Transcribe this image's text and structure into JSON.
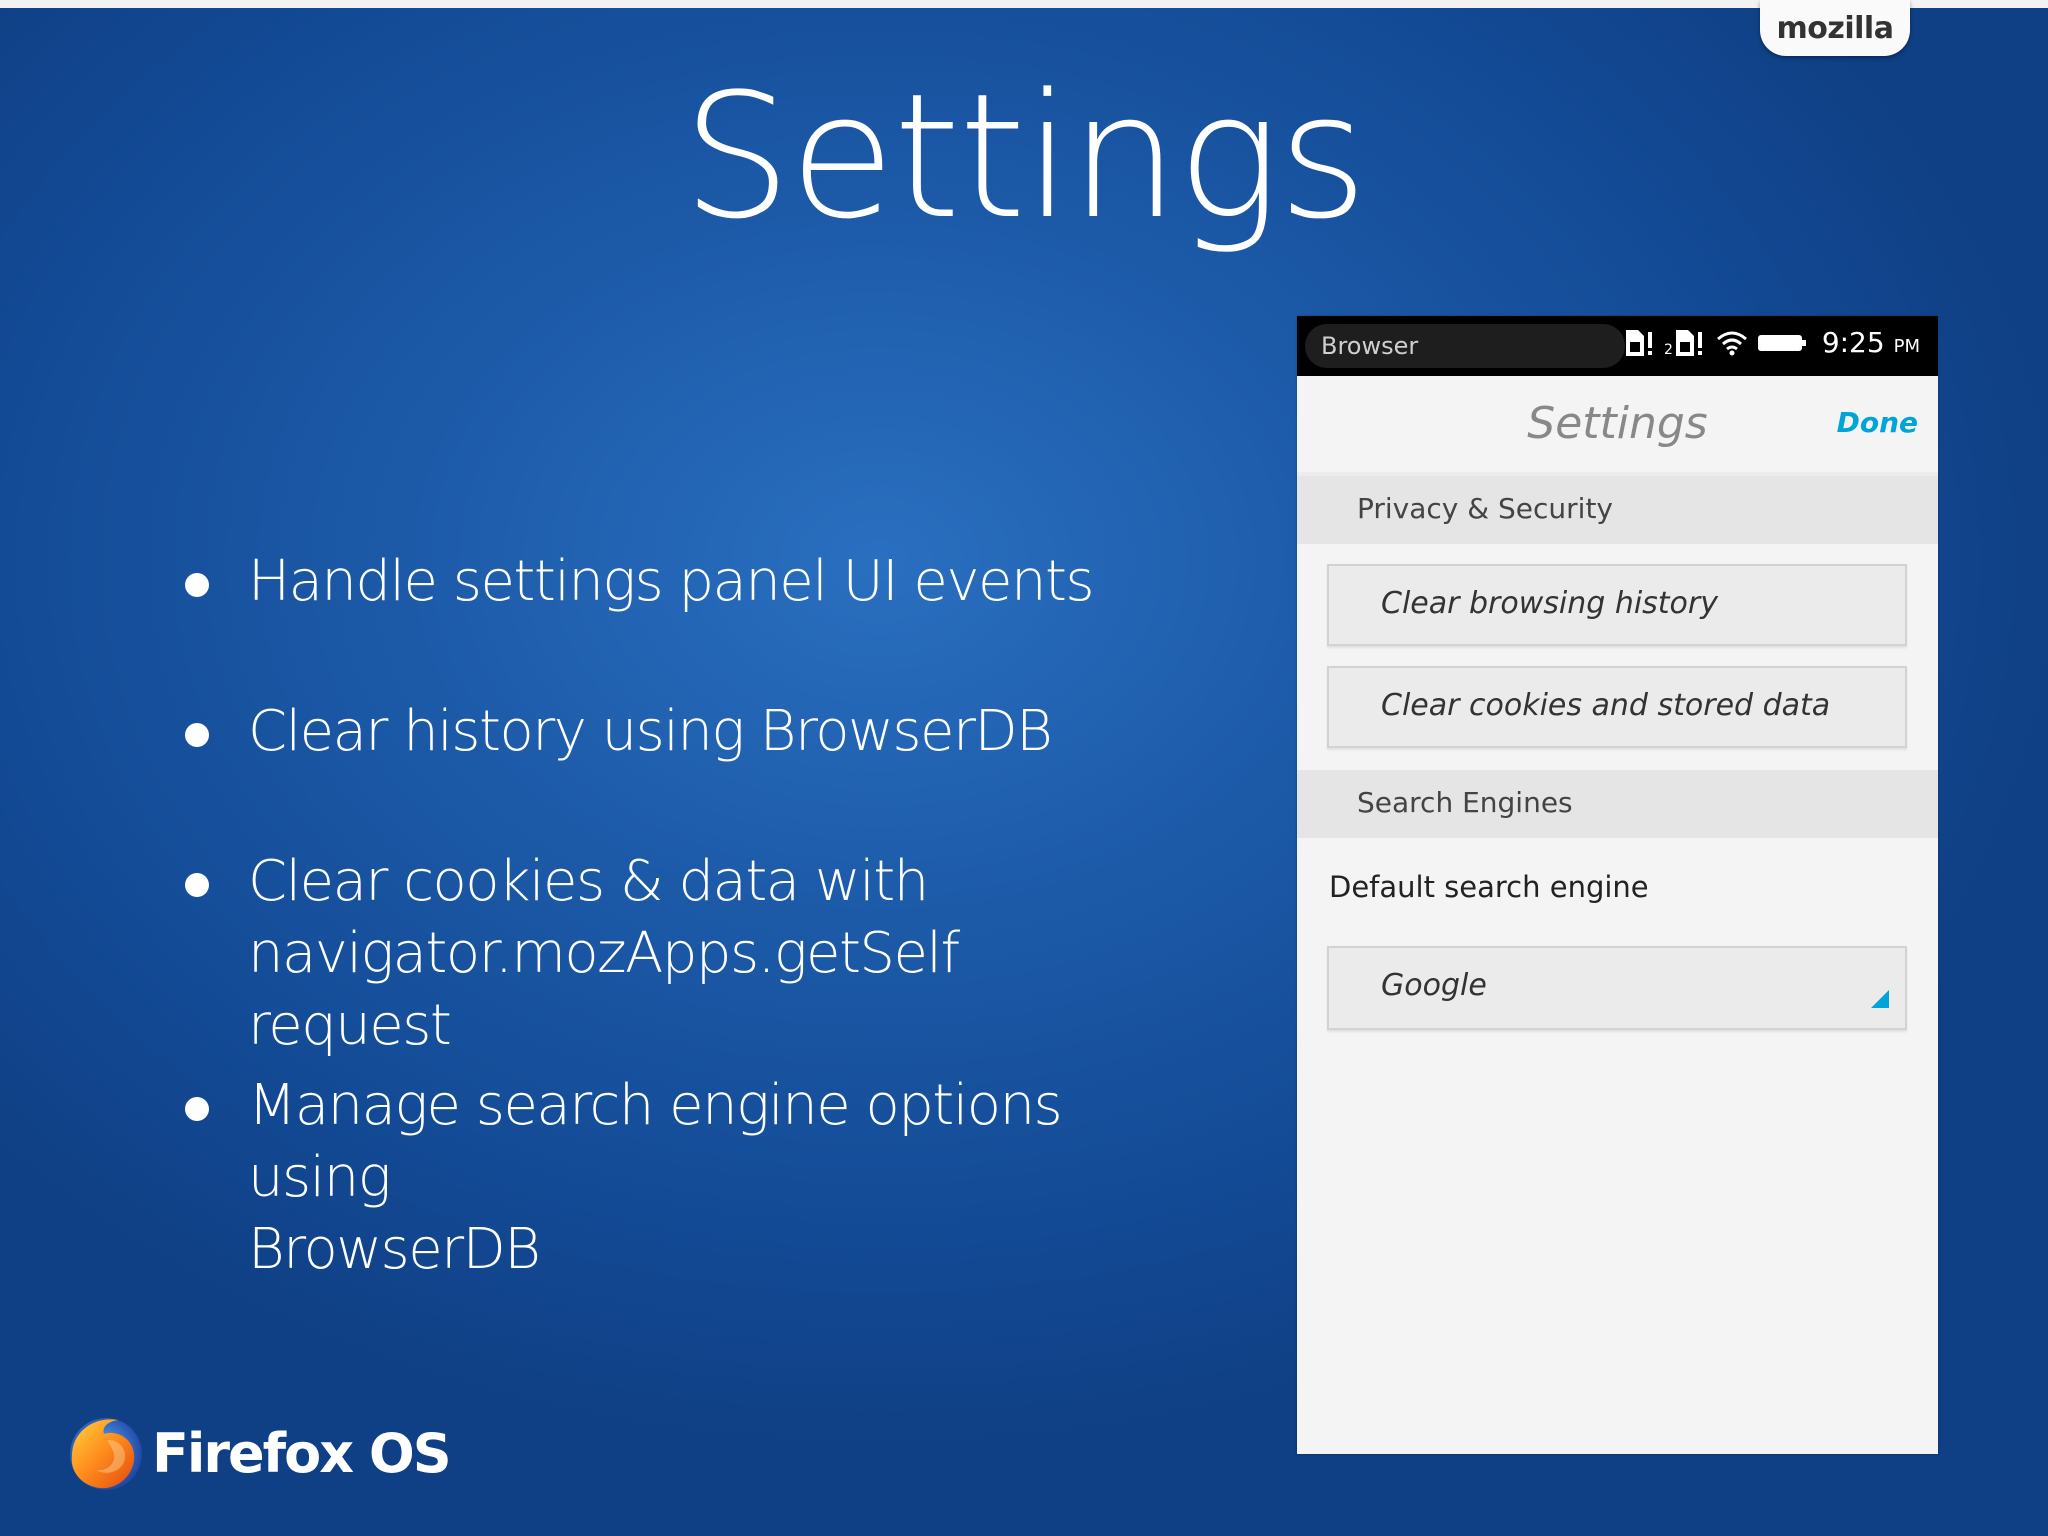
{
  "brand": {
    "tab_label": "mozilla",
    "logo_text": "Firefox OS"
  },
  "slide": {
    "title": "Settings",
    "bullets": [
      {
        "line1": "Handle settings panel UI events"
      },
      {
        "line1": "Clear history using BrowserDB"
      },
      {
        "line1": "Clear cookies & data with",
        "line2": "navigator.mozApps.getSelf request"
      },
      {
        "line1": "Manage search engine options using",
        "line2": "BrowserDB"
      }
    ]
  },
  "phone": {
    "statusbar": {
      "app_name": "Browser",
      "time": "9:25",
      "ampm": "PM",
      "sim1_icon": "sim-card-icon",
      "sim2_icon": "sim-card-2-icon",
      "wifi_icon": "wifi-icon",
      "battery_icon": "battery-icon"
    },
    "header": {
      "title": "Settings",
      "done_label": "Done"
    },
    "sections": {
      "privacy": {
        "title": "Privacy & Security",
        "clear_history_label": "Clear browsing history",
        "clear_cookies_label": "Clear cookies and stored data"
      },
      "search": {
        "title": "Search Engines",
        "default_label": "Default search engine",
        "selected_engine": "Google"
      }
    },
    "colors": {
      "accent": "#00a4d8",
      "statusbar": "#000000"
    }
  },
  "colors": {
    "background": "#1c5aa8",
    "text": "#ffffff"
  }
}
